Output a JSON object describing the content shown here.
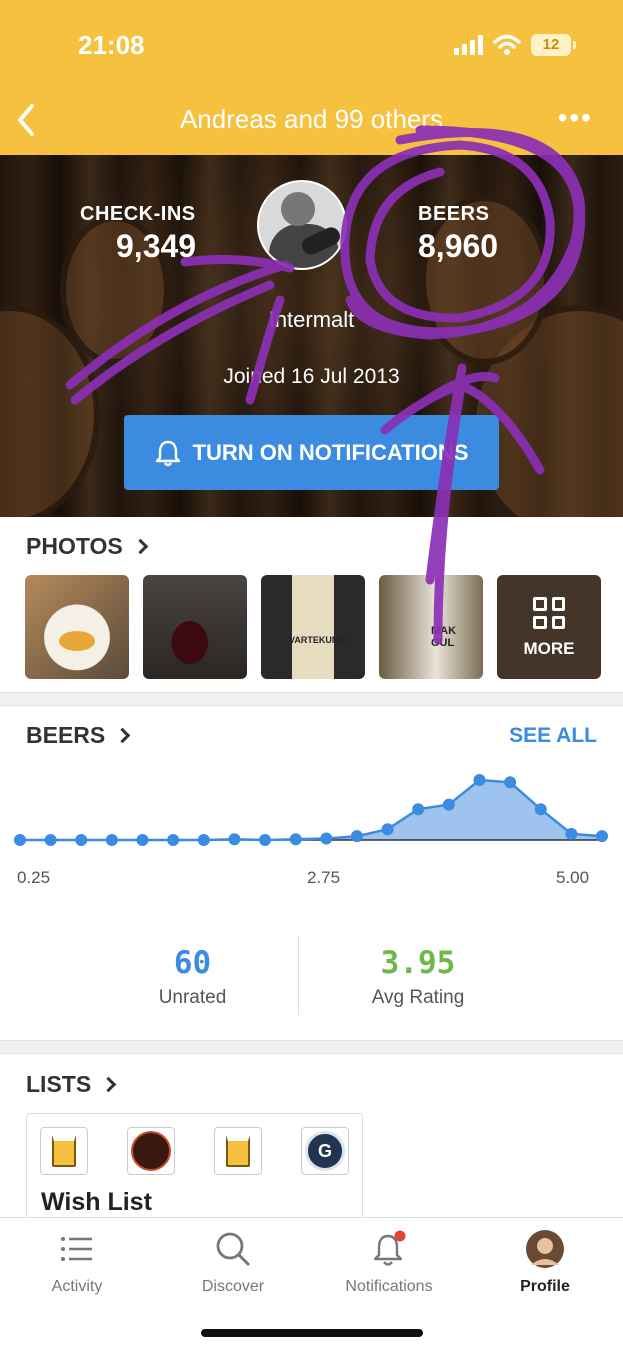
{
  "status_bar": {
    "time": "21:08",
    "battery": "12"
  },
  "nav": {
    "title": "Andreas and 99 others"
  },
  "profile": {
    "checkins_label": "CHECK-INS",
    "checkins_value": "9,349",
    "beers_label": "BEERS",
    "beers_value": "8,960",
    "username": "Intermalt",
    "joined": "Joined 16 Jul 2013",
    "notifications_button": "TURN ON NOTIFICATIONS"
  },
  "photos": {
    "title": "PHOTOS",
    "more_label": "MORE"
  },
  "beers": {
    "title": "BEERS",
    "see_all": "SEE ALL",
    "unrated_value": "60",
    "unrated_label": "Unrated",
    "avg_value": "3.95",
    "avg_label": "Avg Rating"
  },
  "lists": {
    "title": "LISTS",
    "first_list_name": "Wish List",
    "badge_letter": "G"
  },
  "tabs": [
    {
      "label": "Activity",
      "icon": "list-icon"
    },
    {
      "label": "Discover",
      "icon": "search-icon"
    },
    {
      "label": "Notifications",
      "icon": "bell-icon"
    },
    {
      "label": "Profile",
      "icon": "avatar-icon"
    }
  ],
  "colors": {
    "accent": "#F5C13E",
    "blue": "#3B8BE0",
    "green": "#6DB84A",
    "scribble": "#8B2FB5"
  },
  "chart_data": {
    "type": "area",
    "x": [
      0.25,
      0.5,
      0.75,
      1.0,
      1.25,
      1.5,
      1.75,
      2.0,
      2.25,
      2.5,
      2.75,
      3.0,
      3.25,
      3.5,
      3.75,
      4.0,
      4.25,
      4.5,
      4.75,
      5.0
    ],
    "y": [
      0,
      0,
      0,
      0,
      0,
      0,
      0,
      1,
      0,
      1,
      2,
      5,
      14,
      40,
      46,
      78,
      75,
      40,
      8,
      5
    ],
    "xtick_labels": [
      "0.25",
      "2.75",
      "5.00"
    ],
    "xlim": [
      0.25,
      5.0
    ],
    "ylim": [
      0,
      85
    ],
    "grid": false
  }
}
